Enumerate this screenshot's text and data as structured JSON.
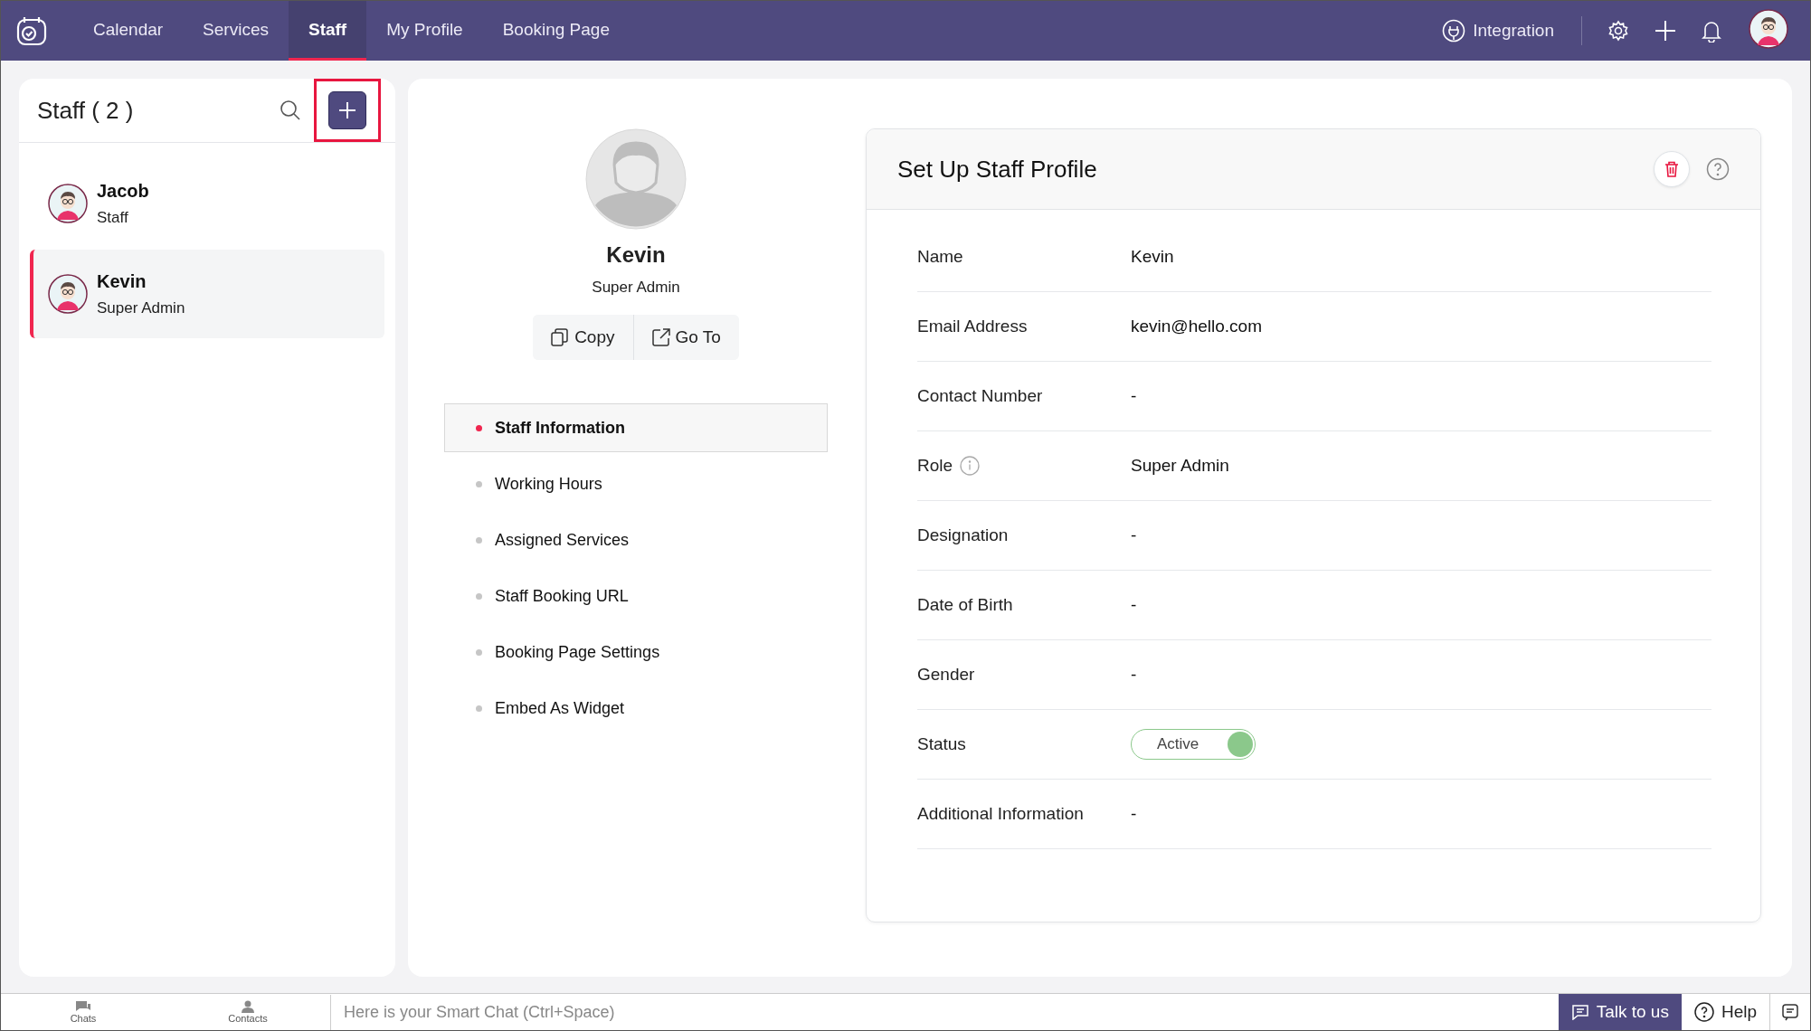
{
  "nav": {
    "tabs": [
      {
        "label": "Calendar",
        "selected": false
      },
      {
        "label": "Services",
        "selected": false
      },
      {
        "label": "Staff",
        "selected": true
      },
      {
        "label": "My Profile",
        "selected": false
      },
      {
        "label": "Booking Page",
        "selected": false
      }
    ],
    "integration": "Integration"
  },
  "staff_list": {
    "title": "Staff ( 2 )",
    "add_highlighted": true,
    "items": [
      {
        "name": "Jacob",
        "role": "Staff",
        "selected": false
      },
      {
        "name": "Kevin",
        "role": "Super Admin",
        "selected": true
      }
    ]
  },
  "profile": {
    "name": "Kevin",
    "role": "Super Admin",
    "actions": [
      "Copy",
      "Go To"
    ],
    "sections": [
      {
        "label": "Staff Information",
        "selected": true
      },
      {
        "label": "Working Hours",
        "selected": false
      },
      {
        "label": "Assigned Services",
        "selected": false
      },
      {
        "label": "Staff Booking URL",
        "selected": false
      },
      {
        "label": "Booking Page Settings",
        "selected": false
      },
      {
        "label": "Embed As Widget",
        "selected": false
      }
    ]
  },
  "card": {
    "title": "Set Up Staff Profile",
    "fields": [
      {
        "kind": "text",
        "label": "Name",
        "value": "Kevin"
      },
      {
        "kind": "text",
        "label": "Email Address",
        "value": "kevin@hello.com"
      },
      {
        "kind": "text",
        "label": "Contact Number",
        "value": "-"
      },
      {
        "kind": "text",
        "label": "Role",
        "value": "Super Admin",
        "info": true
      },
      {
        "kind": "text",
        "label": "Designation",
        "value": "-"
      },
      {
        "kind": "text",
        "label": "Date of Birth",
        "value": "-"
      },
      {
        "kind": "text",
        "label": "Gender",
        "value": "-"
      },
      {
        "kind": "toggle",
        "label": "Status",
        "value": "Active",
        "on": true
      },
      {
        "kind": "text",
        "label": "Additional Information",
        "value": "-"
      }
    ]
  },
  "bottom_bar": {
    "chats": "Chats",
    "contacts": "Contacts",
    "placeholder": "Here is your Smart Chat (Ctrl+Space)",
    "talk": "Talk to us",
    "help": "Help"
  }
}
